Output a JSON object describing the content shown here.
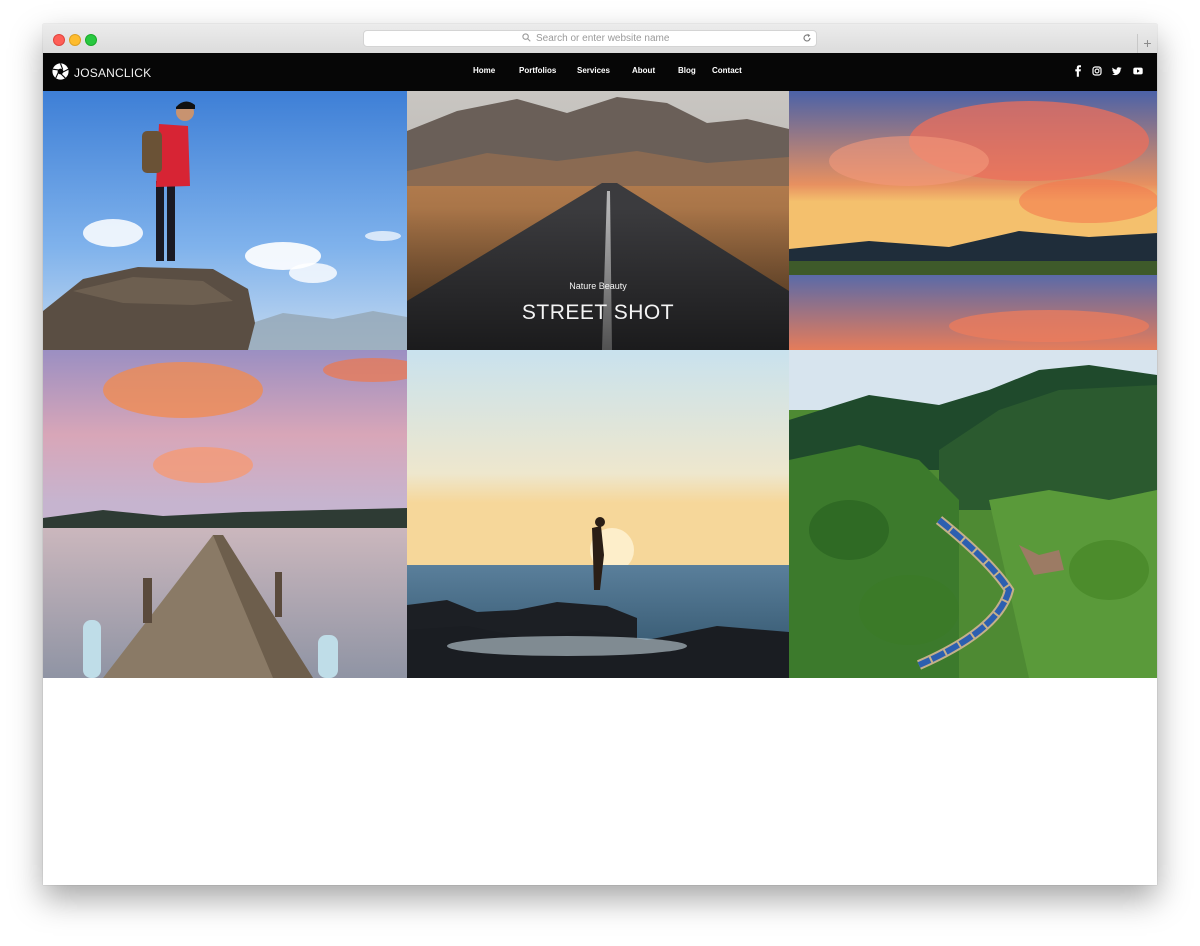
{
  "browser": {
    "address_placeholder": "Search or enter website name",
    "new_tab_label": "+"
  },
  "site": {
    "logo_text": "JOSANCLICK",
    "menu": [
      {
        "label": "Home"
      },
      {
        "label": "Portfolios"
      },
      {
        "label": "Services"
      },
      {
        "label": "About"
      },
      {
        "label": "Blog"
      },
      {
        "label": "Contact"
      }
    ],
    "social_icons": [
      "facebook-icon",
      "instagram-icon",
      "twitter-icon",
      "youtube-icon"
    ]
  },
  "gallery": {
    "featured": {
      "subtitle": "Nature Beauty",
      "title": "STREET SHOT"
    }
  },
  "colors": {
    "nav_background": "#060606",
    "nav_text": "#ffffff"
  }
}
